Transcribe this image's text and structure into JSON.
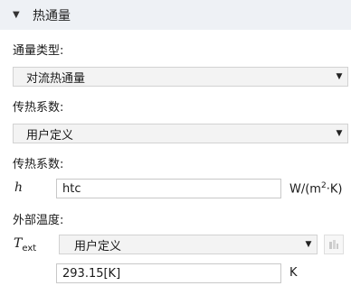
{
  "section": {
    "toggle": "▼",
    "title": "热通量"
  },
  "flux_type": {
    "label": "通量类型:",
    "selected": "对流热通量"
  },
  "htc_def": {
    "label": "传热系数:",
    "selected": "用户定义"
  },
  "htc": {
    "label": "传热系数:",
    "symbol": "h",
    "value": "htc",
    "unit_prefix": "W/(m",
    "unit_sup": "2",
    "unit_suffix": "·K)"
  },
  "ext_temp": {
    "label": "外部温度:",
    "symbol": "T",
    "symbol_sub": "ext",
    "selected": "用户定义",
    "value": "293.15[K]",
    "unit": "K"
  },
  "icons": {
    "collapse": "chevron-down-icon",
    "dropdown": "dropdown-arrow-icon",
    "side_button": "go-to-source-icon"
  }
}
